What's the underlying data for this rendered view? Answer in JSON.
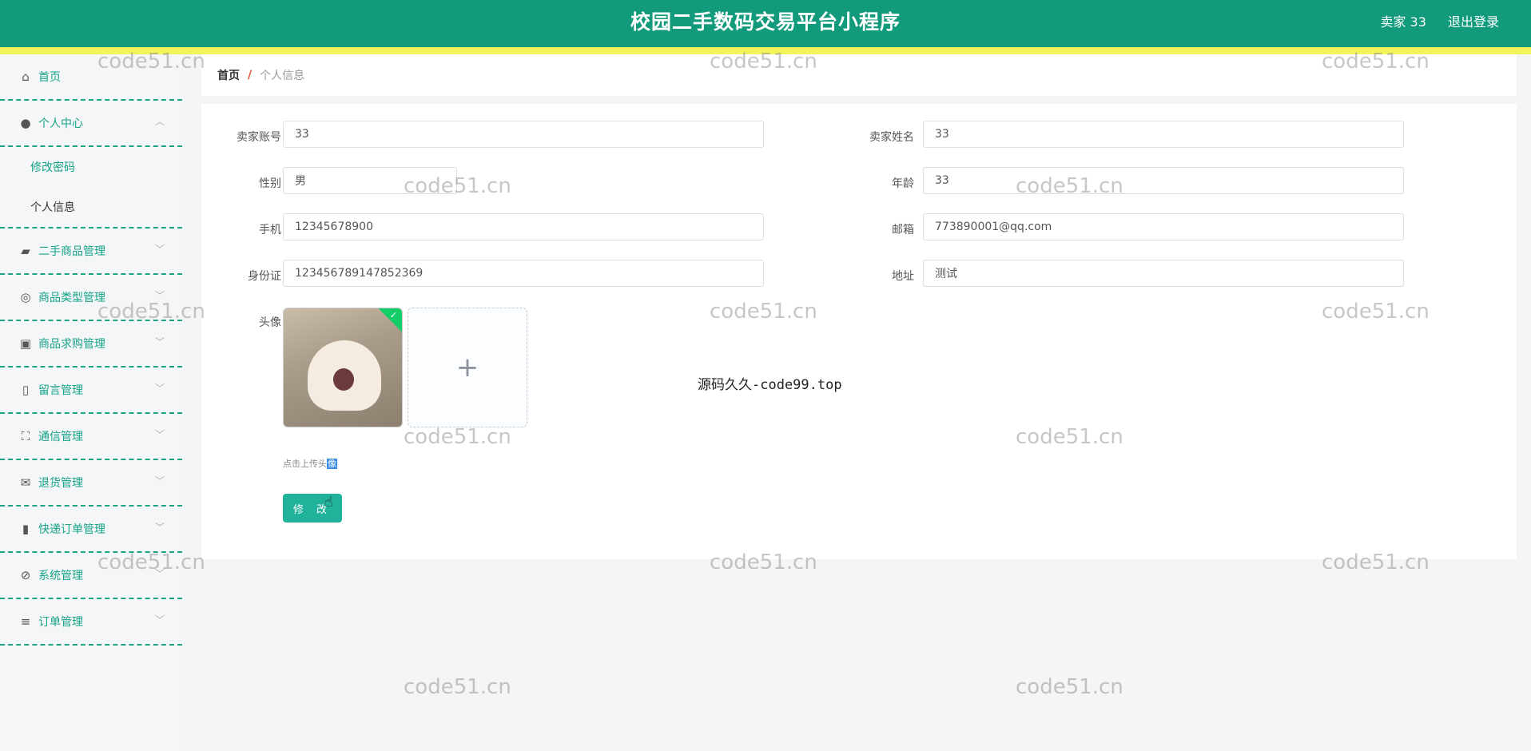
{
  "header": {
    "title": "校园二手数码交易平台小程序",
    "user": "卖家 33",
    "logout": "退出登录"
  },
  "sidebar": {
    "items": [
      {
        "label": "首页",
        "icon": "home-icon"
      },
      {
        "label": "个人中心",
        "icon": "user-icon",
        "expanded": true,
        "children": [
          "修改密码",
          "个人信息"
        ]
      },
      {
        "label": "二手商品管理",
        "icon": "goods-icon"
      },
      {
        "label": "商品类型管理",
        "icon": "compass-icon"
      },
      {
        "label": "商品求购管理",
        "icon": "chart-icon"
      },
      {
        "label": "留言管理",
        "icon": "message-icon"
      },
      {
        "label": "通信管理",
        "icon": "fullscreen-icon"
      },
      {
        "label": "退货管理",
        "icon": "mail-icon"
      },
      {
        "label": "快递订单管理",
        "icon": "bar-chart-icon"
      },
      {
        "label": "系统管理",
        "icon": "settings-icon"
      },
      {
        "label": "订单管理",
        "icon": "list-icon"
      }
    ]
  },
  "breadcrumb": {
    "home": "首页",
    "separator": "/",
    "current": "个人信息"
  },
  "form": {
    "seller_account_label": "卖家账号",
    "seller_account": "33",
    "seller_name_label": "卖家姓名",
    "seller_name": "33",
    "gender_label": "性别",
    "gender": "男",
    "age_label": "年龄",
    "age": "33",
    "phone_label": "手机",
    "phone": "12345678900",
    "email_label": "邮箱",
    "email": "773890001@qq.com",
    "id_card_label": "身份证",
    "id_card": "123456789147852369",
    "address_label": "地址",
    "address": "测试",
    "avatar_label": "头像",
    "upload_plus": "+",
    "upload_tip": "点击上传头",
    "upload_tip_hl": "像",
    "submit": "修 改"
  },
  "center_note": "源码久久-code99.top",
  "watermark": "code51.cn",
  "colors": {
    "header": "#119b7c",
    "stripe": "#f3f35a",
    "accent": "#20b29a"
  }
}
